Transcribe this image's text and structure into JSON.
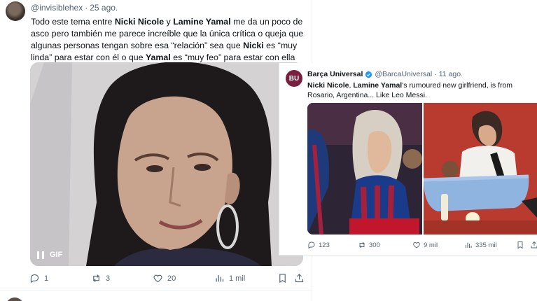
{
  "main_tweet": {
    "handle": "@invisiblehex",
    "separator": "·",
    "date": "25 ago.",
    "text_parts": [
      "Todo este tema entre ",
      "Nicki Nicole",
      " y ",
      "Lamine Yamal",
      " me da un poco de asco pero también me parece increíble que la única crítica o queja que algunas personas tengan sobre esa “relación” sea que ",
      "Nicki",
      " es “muy linda” para estar con él o que ",
      "Yamal",
      " es “muy feo” para estar con ella"
    ],
    "media_label": "GIF",
    "actions": {
      "replies": "1",
      "retweets": "3",
      "likes": "20",
      "views": "1 mil"
    }
  },
  "quoted_tweet": {
    "avatar_text": "BU",
    "name": "Barça Universal",
    "handle": "@BarcaUniversal",
    "separator": "·",
    "date": "11 ago.",
    "text_parts": [
      "Nicki Nicole",
      ", ",
      "Lamine Yamal",
      "'s rumoured new girlfriend, is from Rosario, Argentina... Like Leo Messi."
    ],
    "actions": {
      "replies": "123",
      "retweets": "300",
      "likes": "9 mil",
      "views": "335 mil"
    }
  },
  "colors": {
    "text": "#0f1419",
    "secondary": "#536471",
    "verified": "#1d9bf0",
    "border": "#eff3f4"
  }
}
